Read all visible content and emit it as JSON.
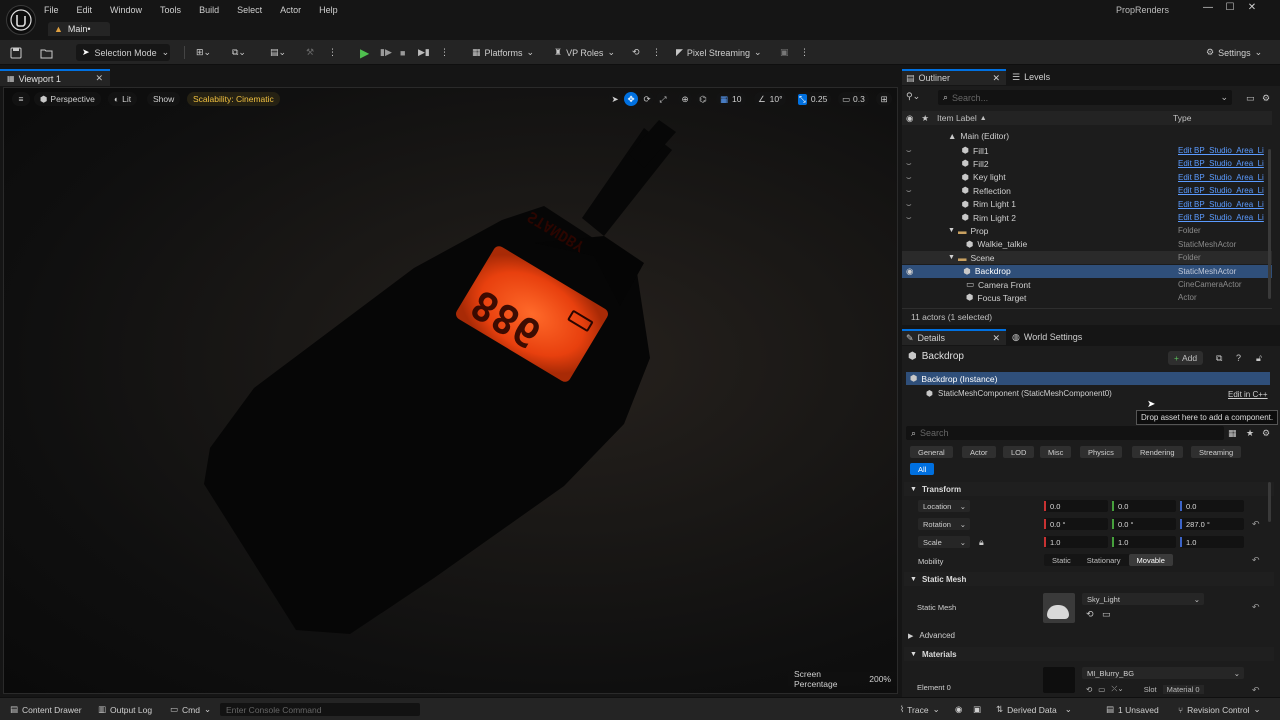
{
  "app": {
    "project_name": "PropRenders",
    "menu": [
      "File",
      "Edit",
      "Window",
      "Tools",
      "Build",
      "Select",
      "Actor",
      "Help"
    ],
    "level_tab": "Main•"
  },
  "toolbar": {
    "selection_mode": "Selection Mode",
    "platforms": "Platforms",
    "vp_roles": "VP Roles",
    "pixel_streaming": "Pixel Streaming",
    "settings": "Settings"
  },
  "viewport": {
    "tab_label": "Viewport 1",
    "perspective": "Perspective",
    "lit": "Lit",
    "show": "Show",
    "scalability": "Scalability: Cinematic",
    "grid_snap": "10",
    "rotation_snap": "10°",
    "scale_snap": "0.25",
    "camera_speed": "0.3",
    "screen_percentage_label": "Screen Percentage",
    "screen_percentage_value": "200%",
    "lcd_digits": "886",
    "lcd_text": "STANDBY"
  },
  "outliner": {
    "tab_label": "Outliner",
    "levels_tab": "Levels",
    "search_placeholder": "Search...",
    "col_label": "Item Label",
    "col_type": "Type",
    "root": "Main (Editor)",
    "rows": [
      {
        "label": "Fill1",
        "type": "Edit BP_Studio_Area_Li"
      },
      {
        "label": "Fill2",
        "type": "Edit BP_Studio_Area_Li"
      },
      {
        "label": "Key light",
        "type": "Edit BP_Studio_Area_Li"
      },
      {
        "label": "Reflection",
        "type": "Edit BP_Studio_Area_Li"
      },
      {
        "label": "Rim Light 1",
        "type": "Edit BP_Studio_Area_Li"
      },
      {
        "label": "Rim Light 2",
        "type": "Edit BP_Studio_Area_Li"
      },
      {
        "label": "Prop",
        "type": "Folder"
      },
      {
        "label": "Walkie_talkie",
        "type": "StaticMeshActor"
      },
      {
        "label": "Scene",
        "type": "Folder"
      },
      {
        "label": "Backdrop",
        "type": "StaticMeshActor"
      },
      {
        "label": "Camera Front",
        "type": "CineCameraActor"
      },
      {
        "label": "Focus Target",
        "type": "Actor"
      }
    ],
    "status": "11 actors (1 selected)"
  },
  "details": {
    "tab_label": "Details",
    "world_settings_tab": "World Settings",
    "actor_name": "Backdrop",
    "add_button": "Add",
    "instance": "Backdrop (Instance)",
    "component": "StaticMeshComponent (StaticMeshComponent0)",
    "edit_cpp": "Edit in C++",
    "tooltip": "Drop asset here to add a component.",
    "search_placeholder": "Search",
    "categories": [
      "General",
      "Actor",
      "LOD",
      "Misc",
      "Physics",
      "Rendering",
      "Streaming",
      "All"
    ],
    "transform": {
      "title": "Transform",
      "location_label": "Location",
      "rotation_label": "Rotation",
      "scale_label": "Scale",
      "location": [
        "0.0",
        "0.0",
        "0.0"
      ],
      "rotation": [
        "0.0 °",
        "0.0 °",
        "287.0 °"
      ],
      "scale": [
        "1.0",
        "1.0",
        "1.0"
      ],
      "mobility_label": "Mobility",
      "mobility_options": [
        "Static",
        "Stationary",
        "Movable"
      ]
    },
    "static_mesh": {
      "title": "Static Mesh",
      "label": "Static Mesh",
      "value": "Sky_Light"
    },
    "advanced": "Advanced",
    "materials": {
      "title": "Materials",
      "element_label": "Element 0",
      "value": "MI_Blurry_BG",
      "slot_label": "Slot",
      "slot_value": "Material 0"
    }
  },
  "statusbar": {
    "content_drawer": "Content Drawer",
    "output_log": "Output Log",
    "cmd": "Cmd",
    "console_placeholder": "Enter Console Command",
    "trace": "Trace",
    "derived_data": "Derived Data",
    "unsaved": "1 Unsaved",
    "revision_control": "Revision Control"
  },
  "colors": {
    "accent": "#0070e0",
    "selection": "#2f4f7a",
    "lcd": "#ff4a12"
  }
}
